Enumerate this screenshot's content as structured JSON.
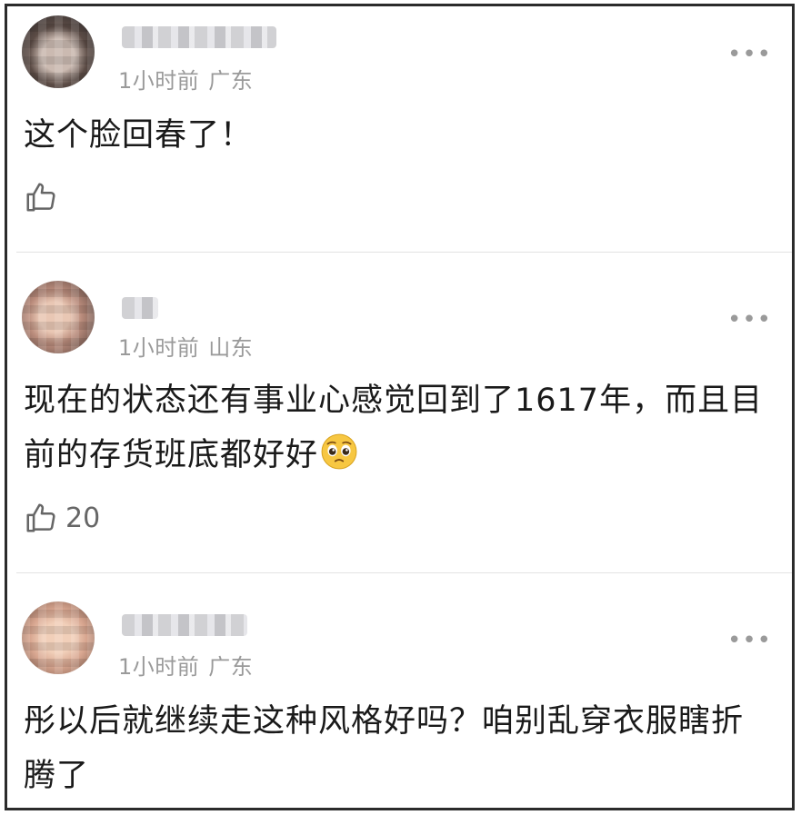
{
  "comments": [
    {
      "meta_time": "1小时前",
      "meta_location": "广东",
      "text": "这个脸回春了！",
      "like_count": ""
    },
    {
      "meta_time": "1小时前",
      "meta_location": "山东",
      "text": "现在的状态还有事业心感觉回到了1617年，而且目前的存货班底都好好",
      "like_count": "20"
    },
    {
      "meta_time": "1小时前",
      "meta_location": "广东",
      "text": "彤以后就继续走这种风格好吗？咱别乱穿衣服瞎折腾了",
      "like_count": ""
    }
  ],
  "ui": {
    "more_glyph": "•••",
    "accent_text": "#1a1a1a",
    "meta_color": "#9a9a9a"
  }
}
